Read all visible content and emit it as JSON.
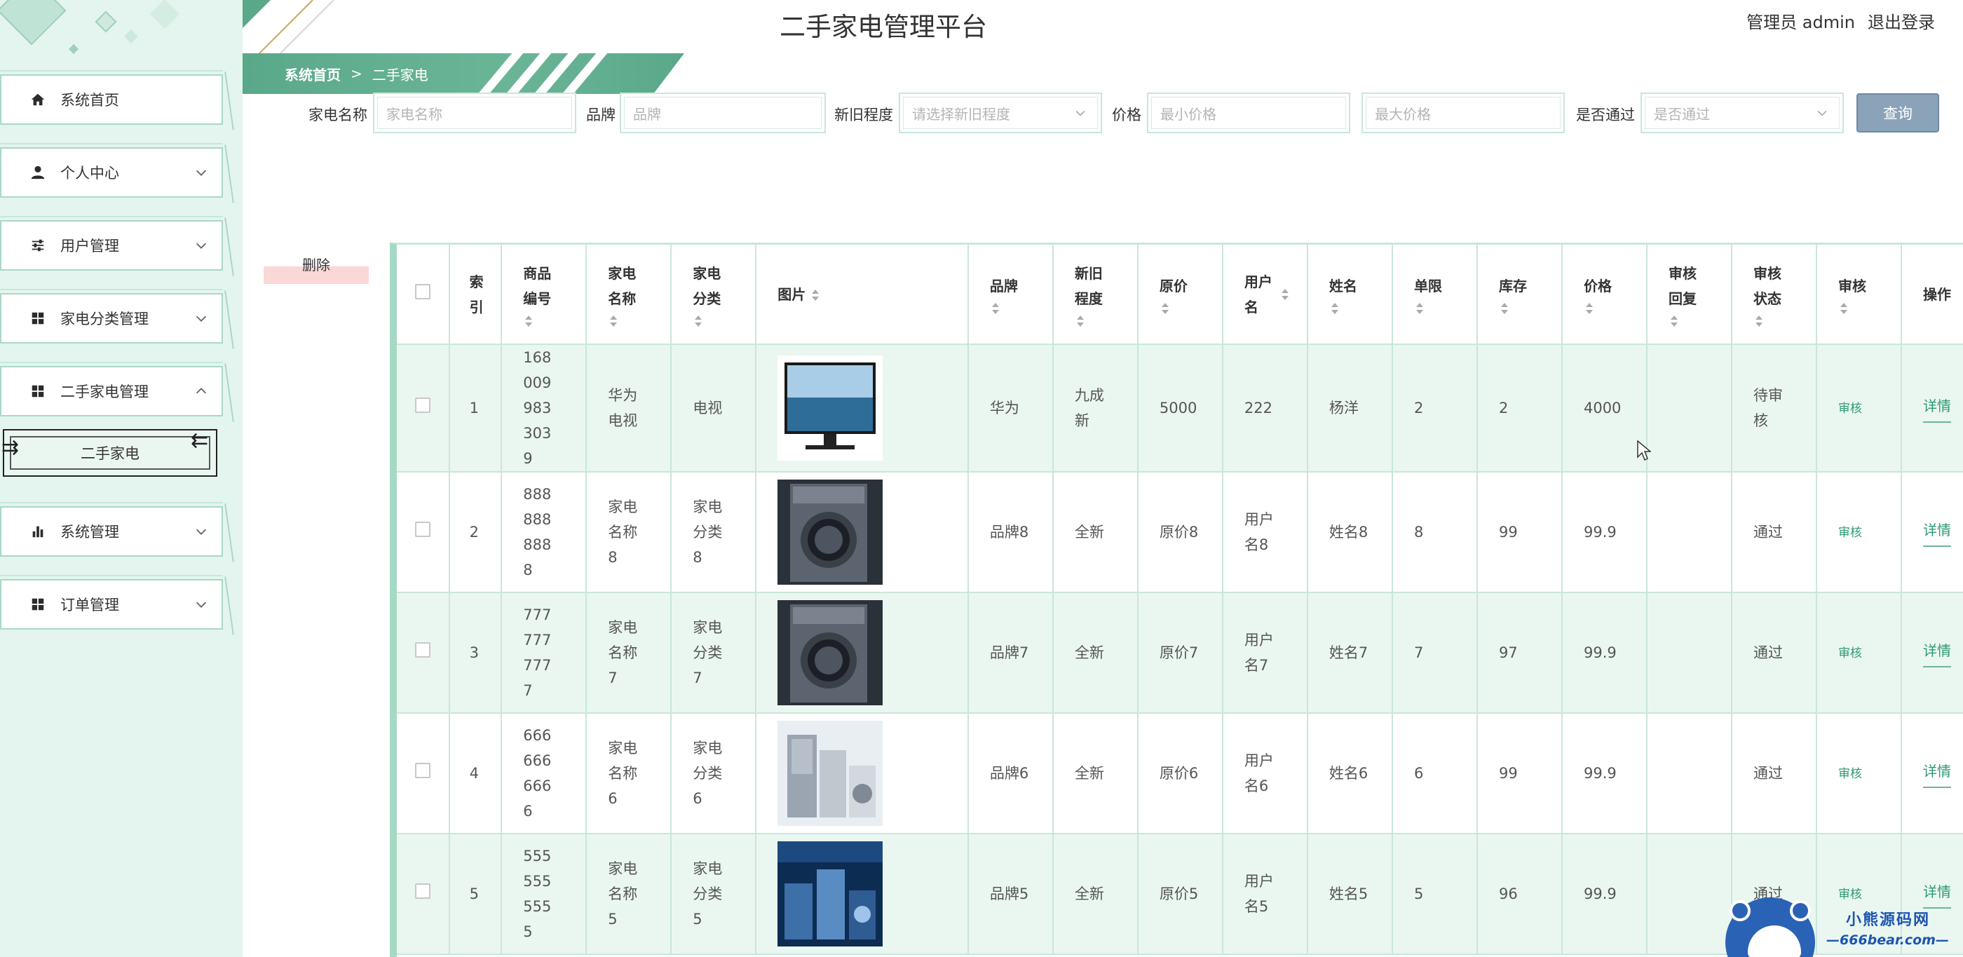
{
  "header": {
    "title": "二手家电管理平台",
    "user_role": "管理员 admin",
    "logout_label": "退出登录"
  },
  "sidebar": {
    "items": [
      {
        "label": "系统首页",
        "icon": "home-icon"
      },
      {
        "label": "个人中心",
        "icon": "user-icon"
      },
      {
        "label": "用户管理",
        "icon": "sliders-icon"
      },
      {
        "label": "家电分类管理",
        "icon": "grid-icon"
      },
      {
        "label": "二手家电管理",
        "icon": "grid-icon"
      },
      {
        "label": "系统管理",
        "icon": "bar-chart-icon"
      },
      {
        "label": "订单管理",
        "icon": "grid-icon"
      }
    ],
    "submenu_label": "二手家电"
  },
  "breadcrumb": {
    "home": "系统首页",
    "separator": ">",
    "current": "二手家电"
  },
  "search": {
    "name_label": "家电名称",
    "name_placeholder": "家电名称",
    "brand_label": "品牌",
    "brand_placeholder": "品牌",
    "condition_label": "新旧程度",
    "condition_placeholder": "请选择新旧程度",
    "price_label": "价格",
    "min_price_placeholder": "最小价格",
    "max_price_placeholder": "最大价格",
    "approved_label": "是否通过",
    "approved_placeholder": "是否通过",
    "query_button": "查询"
  },
  "actions": {
    "delete_label": "删除"
  },
  "table": {
    "headers": {
      "index": "索引",
      "code": "商品编号",
      "name": "家电名称",
      "category": "家电分类",
      "image": "图片",
      "brand": "品牌",
      "condition": "新旧程度",
      "original_price": "原价",
      "username": "用户名",
      "realname": "姓名",
      "limit": "单限",
      "stock": "库存",
      "price": "价格",
      "audit_reply": "审核回复",
      "audit_status": "审核状态",
      "audit": "审核",
      "ops": "操作"
    },
    "rows": [
      {
        "index": "1",
        "code": "1680099833039",
        "name": "华为电视",
        "category": "电视",
        "image": "tv-image",
        "brand": "华为",
        "condition": "九成新",
        "original_price": "5000",
        "username": "222",
        "realname": "杨洋",
        "limit": "2",
        "stock": "2",
        "price": "4000",
        "audit_reply": "",
        "audit_status": "待审核",
        "audit_link": "审核",
        "detail_link": "详情"
      },
      {
        "index": "2",
        "code": "8888888888",
        "name": "家电名称8",
        "category": "家电分类8",
        "image": "washer-image",
        "brand": "品牌8",
        "condition": "全新",
        "original_price": "原价8",
        "username": "用户名8",
        "realname": "姓名8",
        "limit": "8",
        "stock": "99",
        "price": "99.9",
        "audit_reply": "",
        "audit_status": "通过",
        "audit_link": "审核",
        "detail_link": "详情"
      },
      {
        "index": "3",
        "code": "7777777777",
        "name": "家电名称7",
        "category": "家电分类7",
        "image": "washer-image",
        "brand": "品牌7",
        "condition": "全新",
        "original_price": "原价7",
        "username": "用户名7",
        "realname": "姓名7",
        "limit": "7",
        "stock": "97",
        "price": "99.9",
        "audit_reply": "",
        "audit_status": "通过",
        "audit_link": "审核",
        "detail_link": "详情"
      },
      {
        "index": "4",
        "code": "6666666666",
        "name": "家电名称6",
        "category": "家电分类6",
        "image": "appliances-image",
        "brand": "品牌6",
        "condition": "全新",
        "original_price": "原价6",
        "username": "用户名6",
        "realname": "姓名6",
        "limit": "6",
        "stock": "99",
        "price": "99.9",
        "audit_reply": "",
        "audit_status": "通过",
        "audit_link": "审核",
        "detail_link": "详情"
      },
      {
        "index": "5",
        "code": "5555555555",
        "name": "家电名称5",
        "category": "家电分类5",
        "image": "appliances-image",
        "brand": "品牌5",
        "condition": "全新",
        "original_price": "原价5",
        "username": "用户名5",
        "realname": "姓名5",
        "limit": "5",
        "stock": "96",
        "price": "99.9",
        "audit_reply": "",
        "audit_status": "通过",
        "audit_link": "审核",
        "detail_link": "详情"
      }
    ]
  },
  "watermark": {
    "title": "小熊源码网",
    "url": "—666bear.com—"
  },
  "colors": {
    "accent": "#5aa88a",
    "sidebar_bg": "#e3f5ee",
    "row_alt": "#eaf7f1",
    "border": "#c9e6da",
    "query_button": "#8aa3b8",
    "link": "#2d9a70"
  }
}
